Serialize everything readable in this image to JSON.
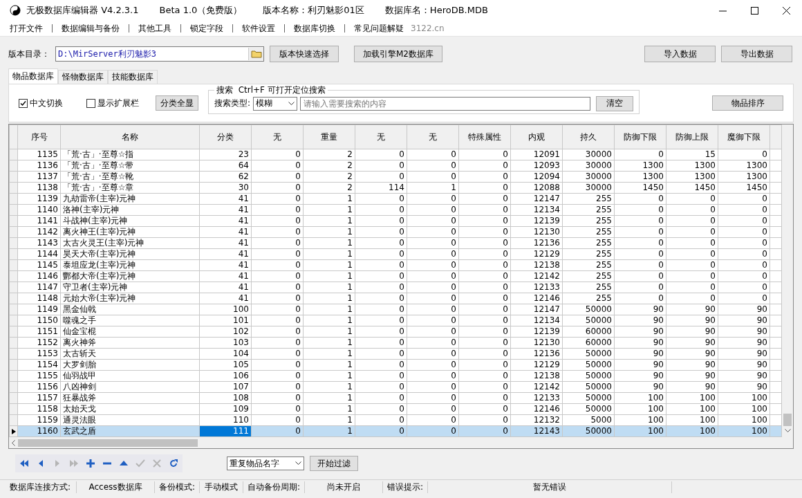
{
  "window": {
    "title_parts": [
      "无极数据库编辑器 V4.2.3.1",
      "Beta 1.0（免费版）",
      "版本名称：利刃魅影01区",
      "数据库名：HeroDB.MDB"
    ]
  },
  "menu": {
    "items": [
      "打开文件",
      "数据编辑与备份",
      "其他工具",
      "锁定字段",
      "软件设置",
      "数据库切换",
      "常见问题解疑"
    ],
    "site": "3122.cn"
  },
  "toolbar": {
    "dir_label": "版本目录：",
    "dir_value": "D:\\MirServer利刃魅影3",
    "buttons_left": [
      "版本快速选择",
      "加载引擎M2数据库"
    ],
    "buttons_right": [
      "导入数据",
      "导出数据"
    ]
  },
  "tabs": [
    {
      "label": "物品数据库",
      "selected": true
    },
    {
      "label": "怪物数据库",
      "selected": false
    },
    {
      "label": "技能数据库",
      "selected": false
    }
  ],
  "options": {
    "checkboxes": [
      {
        "label": "中文切换",
        "checked": true
      },
      {
        "label": "显示扩展栏",
        "checked": false
      }
    ],
    "show_all_button": "分类全显",
    "search_title": "搜索  Ctrl+F 可打开定位搜索",
    "search_type_label": "搜索类型:",
    "search_type": "模糊",
    "search_placeholder": "请输入需要搜索的内容",
    "clear_button": "清空",
    "sort_button": "物品排序"
  },
  "table": {
    "columns": [
      "序号",
      "名称",
      "分类",
      "无",
      "重量",
      "无",
      "无",
      "特殊属性",
      "内观",
      "持久",
      "防御下限",
      "防御上限",
      "魔御下限"
    ],
    "rows": [
      {
        "selected": false,
        "cells": [
          "1135",
          "「荒·古」·至尊☆指",
          "23",
          "0",
          "2",
          "0",
          "0",
          "0",
          "12091",
          "30000",
          "0",
          "15",
          "0"
        ]
      },
      {
        "selected": false,
        "cells": [
          "1136",
          "「荒·古」·至尊☆带",
          "64",
          "0",
          "2",
          "0",
          "0",
          "0",
          "12093",
          "30000",
          "1300",
          "1300",
          "1300"
        ]
      },
      {
        "selected": false,
        "cells": [
          "1137",
          "「荒·古」·至尊☆靴",
          "62",
          "0",
          "2",
          "0",
          "0",
          "0",
          "12094",
          "30000",
          "1300",
          "1300",
          "1300"
        ]
      },
      {
        "selected": false,
        "cells": [
          "1138",
          "「荒·古」·至尊☆章",
          "30",
          "0",
          "2",
          "114",
          "1",
          "0",
          "12088",
          "30000",
          "1450",
          "1450",
          "1450"
        ]
      },
      {
        "selected": false,
        "cells": [
          "1139",
          "九劫雷帝(主宰)元神",
          "41",
          "0",
          "1",
          "0",
          "0",
          "0",
          "12147",
          "255",
          "0",
          "0",
          "0"
        ]
      },
      {
        "selected": false,
        "cells": [
          "1140",
          "洛神(主宰)元神",
          "41",
          "0",
          "1",
          "0",
          "0",
          "0",
          "12134",
          "255",
          "0",
          "0",
          "0"
        ]
      },
      {
        "selected": false,
        "cells": [
          "1141",
          "斗战神(主宰)元神",
          "41",
          "0",
          "1",
          "0",
          "0",
          "0",
          "12139",
          "255",
          "0",
          "0",
          "0"
        ]
      },
      {
        "selected": false,
        "cells": [
          "1142",
          "离火神王(主宰)元神",
          "41",
          "0",
          "1",
          "0",
          "0",
          "0",
          "12130",
          "255",
          "0",
          "0",
          "0"
        ]
      },
      {
        "selected": false,
        "cells": [
          "1143",
          "太古火灵王(主宰)元神",
          "41",
          "0",
          "1",
          "0",
          "0",
          "0",
          "12136",
          "255",
          "0",
          "0",
          "0"
        ]
      },
      {
        "selected": false,
        "cells": [
          "1144",
          "昊天大帝(主宰)元神",
          "41",
          "0",
          "1",
          "0",
          "0",
          "0",
          "12129",
          "255",
          "0",
          "0",
          "0"
        ]
      },
      {
        "selected": false,
        "cells": [
          "1145",
          "泰坦应龙(主宰)元神",
          "41",
          "0",
          "1",
          "0",
          "0",
          "0",
          "12138",
          "255",
          "0",
          "0",
          "0"
        ]
      },
      {
        "selected": false,
        "cells": [
          "1146",
          "酆都大帝(主宰)元神",
          "41",
          "0",
          "1",
          "0",
          "0",
          "0",
          "12142",
          "255",
          "0",
          "0",
          "0"
        ]
      },
      {
        "selected": false,
        "cells": [
          "1147",
          "守卫者(主宰)元神",
          "41",
          "0",
          "1",
          "0",
          "0",
          "0",
          "12133",
          "255",
          "0",
          "0",
          "0"
        ]
      },
      {
        "selected": false,
        "cells": [
          "1148",
          "元始大帝(主宰)元神",
          "41",
          "0",
          "1",
          "0",
          "0",
          "0",
          "12146",
          "255",
          "0",
          "0",
          "0"
        ]
      },
      {
        "selected": false,
        "cells": [
          "1149",
          "黑金仙戟",
          "100",
          "0",
          "1",
          "0",
          "0",
          "0",
          "12147",
          "50000",
          "90",
          "90",
          "90"
        ]
      },
      {
        "selected": false,
        "cells": [
          "1150",
          "噬魂之手",
          "101",
          "0",
          "1",
          "0",
          "0",
          "0",
          "12134",
          "50000",
          "90",
          "90",
          "90"
        ]
      },
      {
        "selected": false,
        "cells": [
          "1151",
          "仙金宝棍",
          "102",
          "0",
          "1",
          "0",
          "0",
          "0",
          "12139",
          "60000",
          "90",
          "90",
          "90"
        ]
      },
      {
        "selected": false,
        "cells": [
          "1152",
          "离火神斧",
          "103",
          "0",
          "1",
          "0",
          "0",
          "0",
          "12130",
          "60000",
          "90",
          "90",
          "90"
        ]
      },
      {
        "selected": false,
        "cells": [
          "1153",
          "太古斩天",
          "104",
          "0",
          "1",
          "0",
          "0",
          "0",
          "12136",
          "50000",
          "90",
          "90",
          "90"
        ]
      },
      {
        "selected": false,
        "cells": [
          "1154",
          "大罗剑胎",
          "105",
          "0",
          "1",
          "0",
          "0",
          "0",
          "12129",
          "50000",
          "90",
          "90",
          "90"
        ]
      },
      {
        "selected": false,
        "cells": [
          "1155",
          "仙羽战甲",
          "106",
          "0",
          "1",
          "0",
          "0",
          "0",
          "12138",
          "50000",
          "90",
          "90",
          "90"
        ]
      },
      {
        "selected": false,
        "cells": [
          "1156",
          "八凶神剑",
          "107",
          "0",
          "1",
          "0",
          "0",
          "0",
          "12142",
          "50000",
          "90",
          "90",
          "90"
        ]
      },
      {
        "selected": false,
        "cells": [
          "1157",
          "狂暴战斧",
          "108",
          "0",
          "1",
          "0",
          "0",
          "0",
          "12133",
          "50000",
          "100",
          "100",
          "100"
        ]
      },
      {
        "selected": false,
        "cells": [
          "1158",
          "太始天戈",
          "109",
          "0",
          "1",
          "0",
          "0",
          "0",
          "12146",
          "50000",
          "100",
          "100",
          "100"
        ]
      },
      {
        "selected": false,
        "cells": [
          "1159",
          "通灵法眼",
          "110",
          "0",
          "1",
          "0",
          "0",
          "0",
          "12132",
          "5000",
          "100",
          "100",
          "100"
        ]
      },
      {
        "selected": true,
        "cells": [
          "1160",
          "玄武之盾",
          {
            "text": "111",
            "current": true
          },
          "0",
          "1",
          "0",
          "0",
          "0",
          "12143",
          "50000",
          "100",
          "100",
          "100"
        ]
      }
    ]
  },
  "navigator": [
    {
      "kind": "first",
      "disabled": false
    },
    {
      "kind": "prior",
      "disabled": false
    },
    {
      "kind": "next",
      "disabled": true
    },
    {
      "kind": "last",
      "disabled": true
    },
    {
      "kind": "insert",
      "disabled": false
    },
    {
      "kind": "delete",
      "disabled": false
    },
    {
      "kind": "edit",
      "disabled": false
    },
    {
      "kind": "post",
      "disabled": true
    },
    {
      "kind": "cancel",
      "disabled": true
    },
    {
      "kind": "refresh",
      "disabled": false
    }
  ],
  "filter": {
    "select": "重复物品名字",
    "button": "开始过滤"
  },
  "status_bar": [
    {
      "label": "数据库连接方式:",
      "value": "Access数据库"
    },
    {
      "label": "备份模式:",
      "value": "手动模式"
    },
    {
      "label": "自动备份周期:",
      "value": "尚未开启"
    },
    {
      "label": "错误提示:",
      "value": "暂无错误"
    }
  ]
}
